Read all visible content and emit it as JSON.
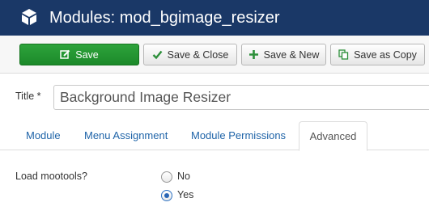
{
  "header": {
    "title": "Modules: mod_bgimage_resizer",
    "icon": "cube-icon",
    "background": "#1a3867"
  },
  "toolbar": {
    "save_label": "Save",
    "save_close_label": "Save & Close",
    "save_new_label": "Save & New",
    "save_copy_label": "Save as Copy",
    "save_color": "#22963a"
  },
  "title_field": {
    "label": "Title",
    "required_marker": "*",
    "value": "Background Image Resizer"
  },
  "tabs": [
    {
      "label": "Module",
      "active": false
    },
    {
      "label": "Menu Assignment",
      "active": false
    },
    {
      "label": "Module Permissions",
      "active": false
    },
    {
      "label": "Advanced",
      "active": true
    }
  ],
  "advanced": {
    "load_mootools": {
      "label": "Load mootools?",
      "options": [
        {
          "label": "No",
          "checked": false
        },
        {
          "label": "Yes",
          "checked": true
        }
      ]
    }
  }
}
